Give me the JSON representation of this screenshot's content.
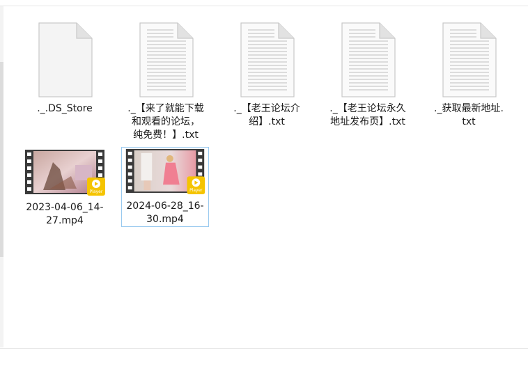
{
  "files": [
    {
      "name": "._.DS_Store",
      "type": "blank",
      "selected": false
    },
    {
      "name": "._【来了就能下载\n和观看的论坛，\n纯免费！】.txt",
      "type": "text",
      "selected": false
    },
    {
      "name": "._【老王论坛介\n绍】.txt",
      "type": "text",
      "selected": false
    },
    {
      "name": "._【老王论坛永久\n地址发布页】.txt",
      "type": "text",
      "selected": false
    },
    {
      "name": "._获取最新地址.\ntxt",
      "type": "text",
      "selected": false
    },
    {
      "name": "2023-04-06_14-\n27.mp4",
      "type": "video",
      "selected": false,
      "badge": "Player"
    },
    {
      "name": "2024-06-28_16-\n30.mp4",
      "type": "video",
      "selected": true,
      "badge": "Player"
    }
  ],
  "colors": {
    "selection_border": "#99c9ef",
    "doc_fold": "#dcdcdc",
    "player_badge": "#f5c400",
    "film_strip": "#3a3a3a"
  },
  "icons": [
    "blank-document-icon",
    "text-document-icon",
    "video-thumbnail-icon",
    "player-badge-icon"
  ]
}
